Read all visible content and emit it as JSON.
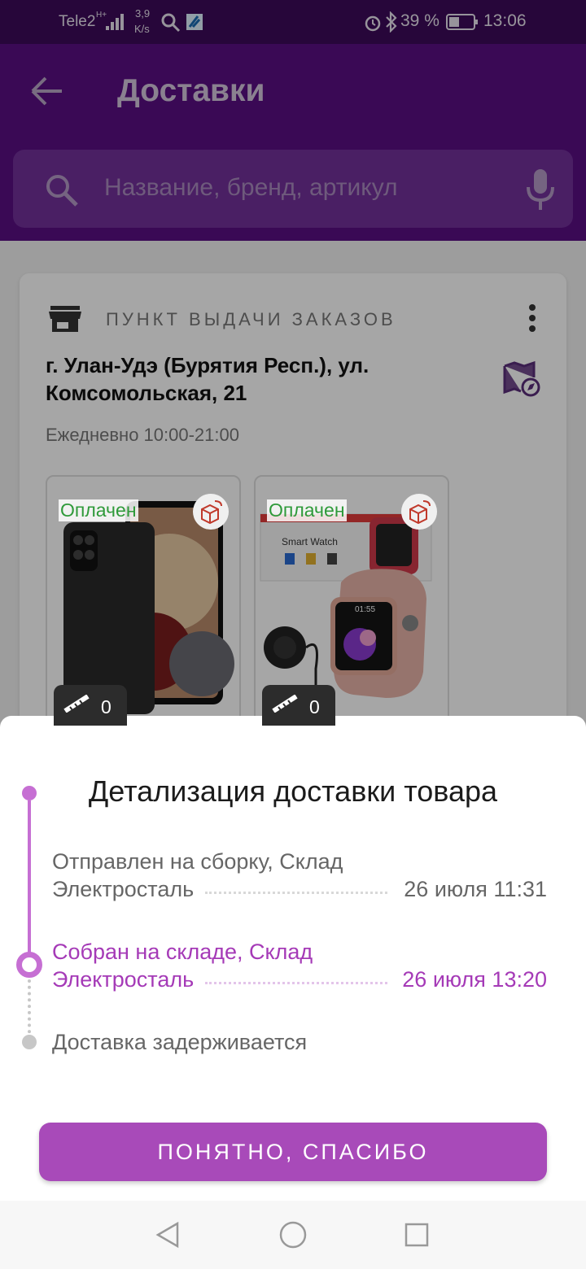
{
  "status_bar": {
    "carrier": "Tele2",
    "net_type": "H+",
    "speed": "3,9",
    "speed_unit": "K/s",
    "battery": "39 %",
    "time": "13:06"
  },
  "header": {
    "title": "Доставки"
  },
  "search": {
    "placeholder": "Название, бренд, артикул"
  },
  "pickup_card": {
    "type_label": "ПУНКТ ВЫДАЧИ ЗАКАЗОВ",
    "address": "г. Улан-Удэ (Бурятия Респ.), ул. Комсомольская, 21",
    "hours": "Ежедневно 10:00-21:00",
    "products": [
      {
        "status": "Оплачен",
        "count": "0"
      },
      {
        "status": "Оплачен",
        "count": "0",
        "screen_time": "01:55",
        "package_text": "Smart Watch"
      }
    ]
  },
  "sheet": {
    "title": "Детализация доставки товара",
    "steps": [
      {
        "line1": "Отправлен на сборку, Склад",
        "line2": "Электросталь",
        "time": "26 июля 11:31",
        "state": "done"
      },
      {
        "line1": "Собран на складе, Склад",
        "line2": "Электросталь",
        "time": "26 июля 13:20",
        "state": "current"
      },
      {
        "line1": "Доставка задерживается",
        "state": "pending"
      }
    ],
    "button": "ПОНЯТНО, СПАСИБО"
  },
  "colors": {
    "brand_dark": "#5a0e83",
    "accent": "#a84ab9",
    "paid_green": "#2f9a3a"
  }
}
